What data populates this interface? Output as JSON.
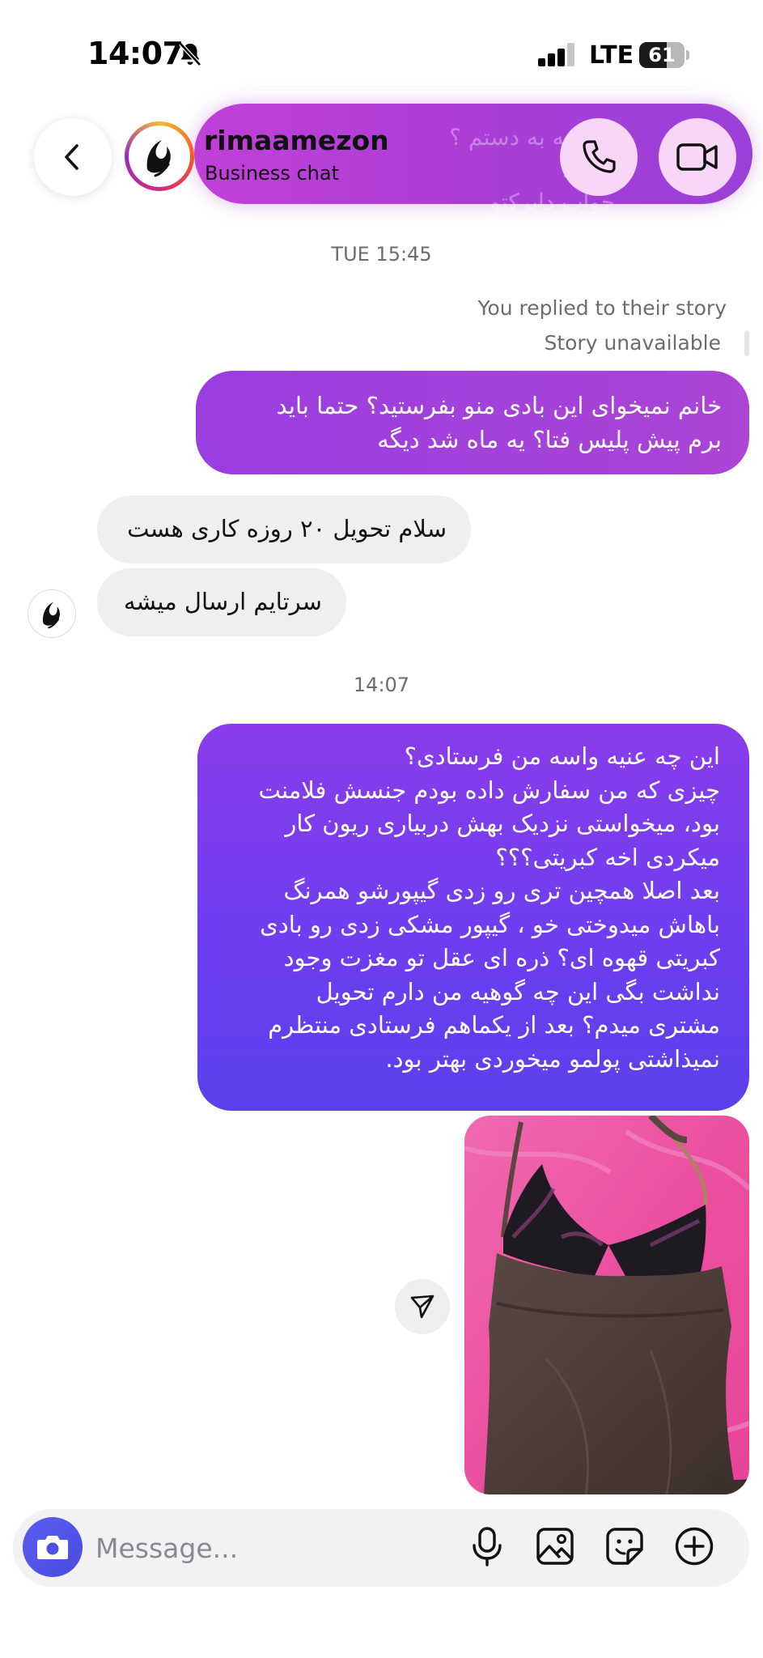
{
  "status_bar": {
    "time": "14:07",
    "network": "LTE",
    "battery": "61"
  },
  "header": {
    "username": "rimaamezon",
    "subtitle": "Business chat",
    "ghost_text": "میرسه به دستم ؟ حدودا\nجواب دایرکتو"
  },
  "conversation": {
    "timestamp_1": "TUE 15:45",
    "story_note": "You replied to their story",
    "story_unavailable": "Story unavailable",
    "outgoing_1": "خانم نمیخوای این بادی منو بفرستید؟ حتما باید\nبرم پیش پلیس فتا؟ یه ماه شد دیگه",
    "incoming_1": "سلام تحویل ۲۰ روزه کاری هست",
    "incoming_2": "سرتایم ارسال میشه",
    "timestamp_2": "14:07",
    "outgoing_2": "این چه عنیه واسه من فرستادی؟\nچیزی که من سفارش داده بودم جنسش فلامنت\nبود، میخواستی نزدیک بهش دربیاری ریون کار\nمیکردی اخه کبریتی؟؟؟\nبعد اصلا همچین تری رو زدی گیپورشو همرنگ\nباهاش میدوختی خو ، گیپور مشکی زدی رو بادی\nکبریتی قهوه ای؟ ذره ای عقل تو مغزت وجود\nنداشت بگی این چه گوهیه من دارم تحویل\nمشتری میدم؟ بعد از یکماهم فرستادی منتظرم\nنمیذاشتی پولمو میخوردی بهتر بود."
  },
  "composer": {
    "placeholder": "Message..."
  },
  "icons": {
    "back": "chevron-left-icon",
    "call": "phone-icon",
    "video": "video-camera-icon",
    "share": "send-icon",
    "camera": "camera-icon",
    "mic": "microphone-icon",
    "gallery": "image-icon",
    "sticker": "sticker-icon",
    "add": "plus-circle-icon"
  },
  "colors": {
    "outgoing_top": "#9a3ee0",
    "outgoing_bottom": "#5a40ec",
    "incoming": "#efeff0",
    "call_buttons": "#f8d6f7",
    "camera_button": "#5b5cf0"
  }
}
